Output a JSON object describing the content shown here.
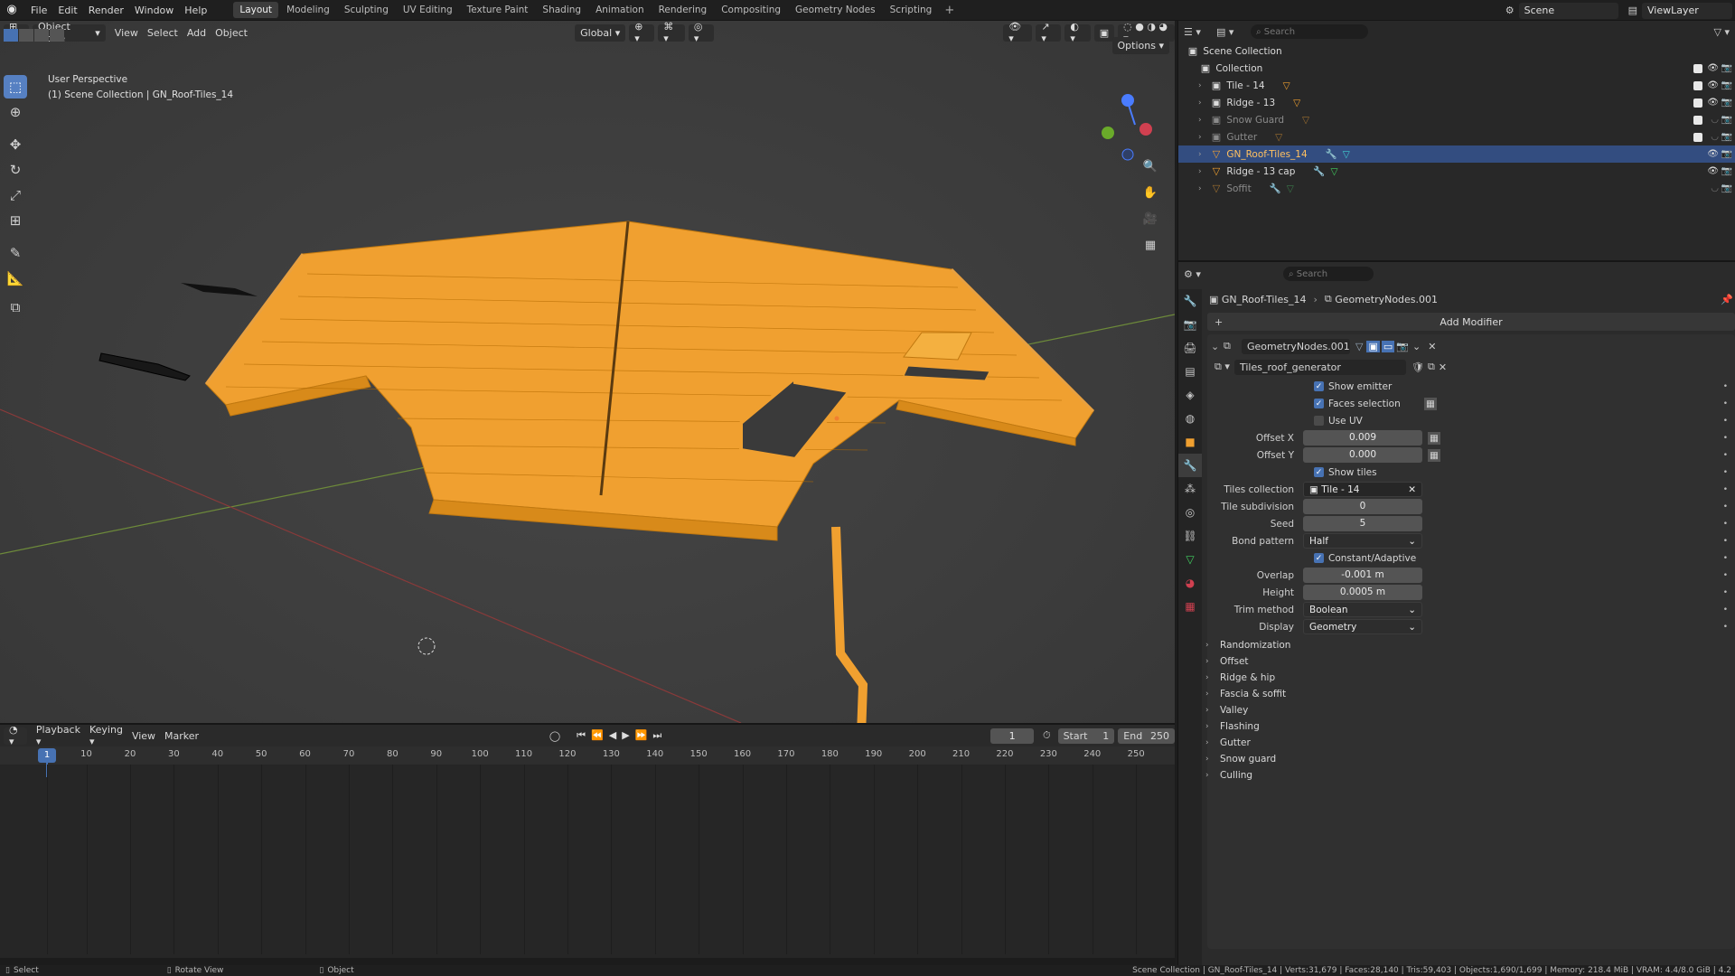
{
  "topbar": {
    "menus": [
      "File",
      "Edit",
      "Render",
      "Window",
      "Help"
    ],
    "workspaces": [
      "Layout",
      "Modeling",
      "Sculpting",
      "UV Editing",
      "Texture Paint",
      "Shading",
      "Animation",
      "Rendering",
      "Compositing",
      "Geometry Nodes",
      "Scripting"
    ],
    "active_workspace": "Layout",
    "add_workspace": "+",
    "scene": "Scene",
    "view_layer": "ViewLayer"
  },
  "viewport": {
    "mode": "Object Mode",
    "menus": [
      "View",
      "Select",
      "Add",
      "Object"
    ],
    "orientation": "Global",
    "options_label": "Options",
    "info_line1": "User Perspective",
    "info_line2": "(1) Scene Collection | GN_Roof-Tiles_14",
    "gizmo_labels": {
      "z": "Z",
      "y": "Y",
      "x": "X"
    }
  },
  "outliner": {
    "search_placeholder": "Search",
    "root": "Scene Collection",
    "items": [
      {
        "label": "Collection",
        "dim": false,
        "selected": false
      },
      {
        "label": "Tile - 14",
        "dim": false,
        "selected": false
      },
      {
        "label": "Ridge - 13",
        "dim": false,
        "selected": false
      },
      {
        "label": "Snow Guard",
        "dim": true,
        "selected": false
      },
      {
        "label": "Gutter",
        "dim": true,
        "selected": false
      },
      {
        "label": "GN_Roof-Tiles_14",
        "dim": false,
        "selected": true
      },
      {
        "label": "Ridge - 13 cap",
        "dim": false,
        "selected": false
      },
      {
        "label": "Soffit",
        "dim": true,
        "selected": false
      }
    ]
  },
  "properties": {
    "search_placeholder": "Search",
    "breadcrumb_object": "GN_Roof-Tiles_14",
    "breadcrumb_modifier": "GeometryNodes.001",
    "add_modifier": "Add Modifier",
    "modifier_name": "GeometryNodes.001",
    "node_group": "Tiles_roof_generator",
    "show_emitter": "Show emitter",
    "faces_selection": "Faces selection",
    "use_uv": "Use UV",
    "offset_x_label": "Offset X",
    "offset_x": "0.009",
    "offset_y_label": "Offset Y",
    "offset_y": "0.000",
    "show_tiles": "Show tiles",
    "tiles_collection_label": "Tiles collection",
    "tiles_collection": "Tile - 14",
    "tile_subdivision_label": "Tile subdivision",
    "tile_subdivision": "0",
    "seed_label": "Seed",
    "seed": "5",
    "bond_pattern_label": "Bond pattern",
    "bond_pattern": "Half",
    "constant_adaptive": "Constant/Adaptive",
    "overlap_label": "Overlap",
    "overlap": "-0.001 m",
    "height_label": "Height",
    "height": "0.0005 m",
    "trim_method_label": "Trim method",
    "trim_method": "Boolean",
    "display_label": "Display",
    "display": "Geometry",
    "panels": [
      "Randomization",
      "Offset",
      "Ridge & hip",
      "Fascia & soffit",
      "Valley",
      "Flashing",
      "Gutter",
      "Snow guard",
      "Culling"
    ]
  },
  "timeline": {
    "menus": [
      "Playback",
      "Keying",
      "View",
      "Marker"
    ],
    "current_frame": "1",
    "start_label": "Start",
    "start": "1",
    "end_label": "End",
    "end": "250",
    "ticks": [
      "1",
      "10",
      "20",
      "30",
      "40",
      "50",
      "60",
      "70",
      "80",
      "90",
      "100",
      "110",
      "120",
      "130",
      "140",
      "150",
      "160",
      "170",
      "180",
      "190",
      "200",
      "210",
      "220",
      "230",
      "240",
      "250"
    ]
  },
  "statusbar": {
    "select": "Select",
    "rotate": "Rotate View",
    "object": "Object",
    "stats": "Scene Collection | GN_Roof-Tiles_14 | Verts:31,679 | Faces:28,140 | Tris:59,403 | Objects:1,690/1,699 | Memory: 218.4 MiB | VRAM: 4.4/8.0 GiB | 4.2"
  },
  "colors": {
    "accent": "#4772b3",
    "selection": "#f0a030",
    "outliner_selected": "#334d80"
  }
}
